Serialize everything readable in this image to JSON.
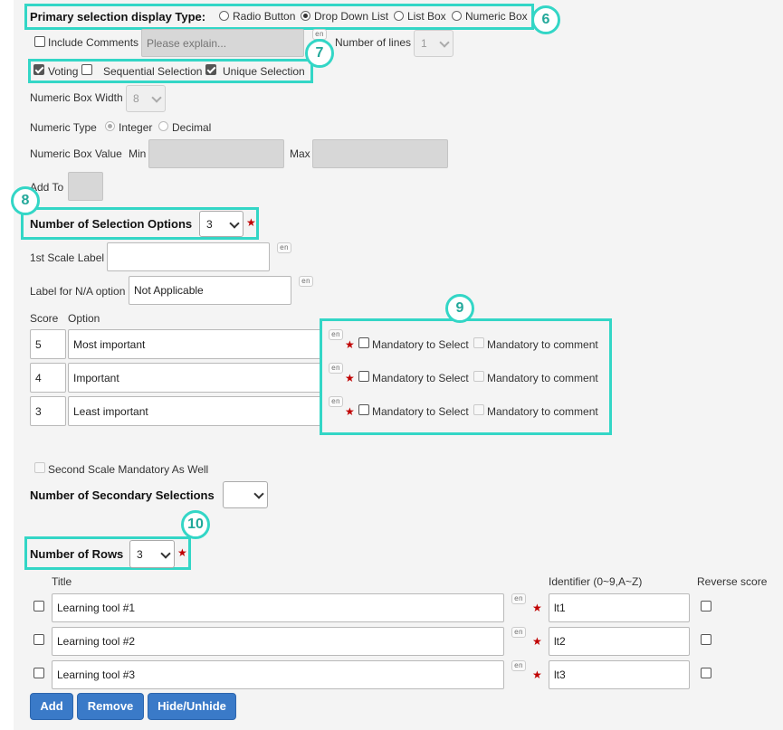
{
  "display_type": {
    "label": "Primary selection display Type:",
    "options": [
      "Radio Button",
      "Drop Down List",
      "List Box",
      "Numeric Box"
    ],
    "selected": "Drop Down List"
  },
  "comments": {
    "label": "Include Comments",
    "placeholder": "Please explain...",
    "lang": "en",
    "lines_label": "Number of lines",
    "lines_value": "1"
  },
  "flags": {
    "voting": "Voting",
    "sequential": "Sequential Selection",
    "unique": "Unique Selection"
  },
  "numeric": {
    "box_width_label": "Numeric Box Width",
    "box_width_value": "8",
    "type_label": "Numeric Type",
    "integer": "Integer",
    "decimal": "Decimal",
    "value_label": "Numeric Box Value",
    "min": "Min",
    "max": "Max",
    "add_to": "Add To"
  },
  "selection_options": {
    "label": "Number of Selection Options",
    "value": "3",
    "first_scale_label": "1st Scale Label",
    "first_scale_lang": "en",
    "na_label": "Label for N/A option",
    "na_value": "Not Applicable",
    "na_lang": "en",
    "score_header": "Score",
    "option_header": "Option",
    "mandatory_select": "Mandatory to Select",
    "mandatory_comment": "Mandatory to comment",
    "items": [
      {
        "score": "5",
        "option": "Most important",
        "lang": "en"
      },
      {
        "score": "4",
        "option": "Important",
        "lang": "en"
      },
      {
        "score": "3",
        "option": "Least important",
        "lang": "en"
      }
    ]
  },
  "second_scale": {
    "mandatory_label": "Second Scale Mandatory As Well",
    "secondary_label": "Number of Secondary Selections",
    "secondary_value": ""
  },
  "rows": {
    "label": "Number of Rows",
    "value": "3",
    "title_header": "Title",
    "identifier_header": "Identifier (0~9,A~Z)",
    "reverse_header": "Reverse score",
    "items": [
      {
        "title": "Learning tool #1",
        "id": "lt1",
        "lang": "en"
      },
      {
        "title": "Learning tool #2",
        "id": "lt2",
        "lang": "en"
      },
      {
        "title": "Learning tool #3",
        "id": "lt3",
        "lang": "en"
      }
    ]
  },
  "buttons": {
    "add": "Add",
    "remove": "Remove",
    "hide": "Hide/Unhide"
  },
  "callouts": [
    "6",
    "7",
    "8",
    "9",
    "10"
  ],
  "colors": {
    "highlight": "#33d6c6",
    "button": "#3a7ac8",
    "required": "#c00000"
  }
}
